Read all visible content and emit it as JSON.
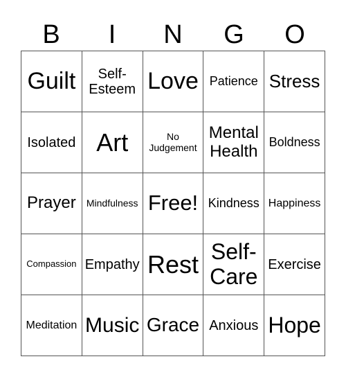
{
  "header": [
    "B",
    "I",
    "N",
    "G",
    "O"
  ],
  "cells": [
    "Guilt",
    "Self-\nEsteem",
    "Love",
    "Patience",
    "Stress",
    "Isolated",
    "Art",
    "No\nJudgement",
    "Mental\nHealth",
    "Boldness",
    "Prayer",
    "Mindfulness",
    "Free!",
    "Kindness",
    "Happiness",
    "Compassion",
    "Empathy",
    "Rest",
    "Self-\nCare",
    "Exercise",
    "Meditation",
    "Music",
    "Grace",
    "Anxious",
    "Hope"
  ]
}
